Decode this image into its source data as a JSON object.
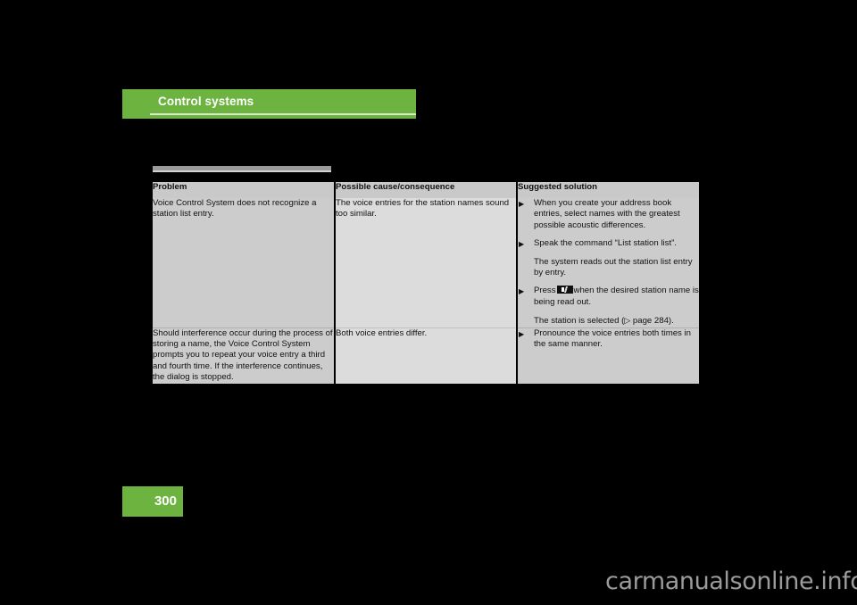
{
  "chapter": {
    "title": "Control systems",
    "accent_color": "#6cb33f"
  },
  "page": {
    "number": "300",
    "background_color": "#000000",
    "watermark": "carmanualsonline.info"
  },
  "table": {
    "headers": {
      "problem": "Problem",
      "cause": "Possible cause/consequence",
      "solution": "Suggested solution"
    },
    "rows": [
      {
        "problem": "Voice Control System does not recognize a station list entry.",
        "cause": "The voice entries for the station names sound too similar.",
        "solution_blocks": [
          {
            "kind": "bullet",
            "text": "When you create your address book entries, select names with the greatest possible acoustic differences."
          },
          {
            "kind": "bullet",
            "text": "Speak the command “List station list”."
          },
          {
            "kind": "note",
            "text": "The system reads out the station list entry by entry."
          },
          {
            "kind": "bullet-with-key",
            "text_before": "Press",
            "key_icon": "voice-key-icon",
            "text_after": "when the desired station name is being read out."
          },
          {
            "kind": "note-ref",
            "text_before": "The station is selected (",
            "ref_arrow": "▷",
            "text_after": " page 284)."
          }
        ]
      },
      {
        "problem": "Should interference occur during the process of storing a name, the Voice Control System prompts you to repeat your voice entry a third and fourth time. If the interference continues, the dialog is stopped.",
        "cause": "Both voice entries differ.",
        "solution_blocks": [
          {
            "kind": "bullet",
            "text": "Pronounce the voice entries both times in the same manner."
          }
        ]
      }
    ]
  }
}
